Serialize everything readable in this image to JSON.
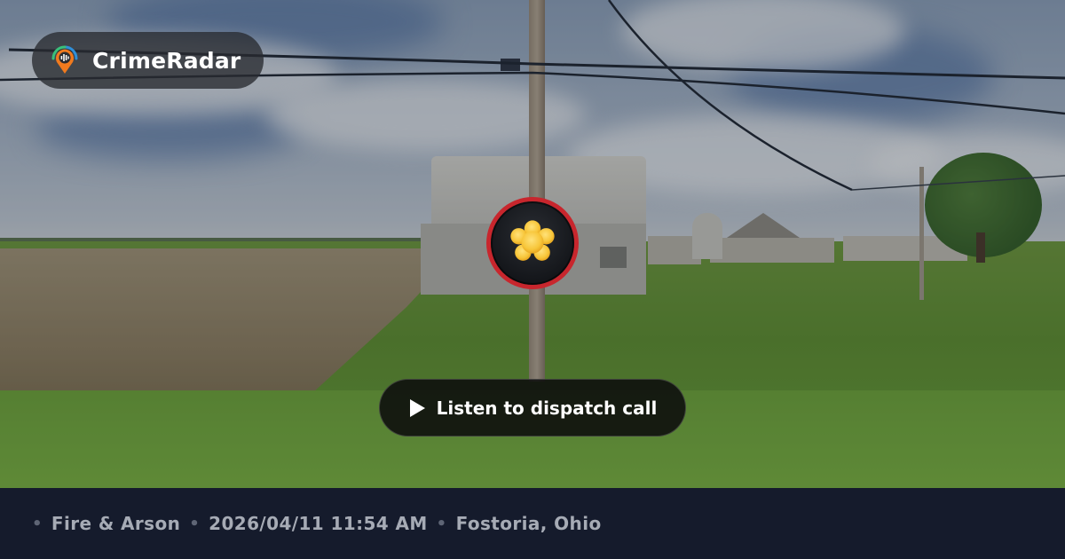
{
  "brand": {
    "name": "CrimeRadar",
    "logo_icon": "radar-pin-logo-icon",
    "colors": {
      "pin_orange": "#f07a1e",
      "pin_green": "#39c07a",
      "pin_blue": "#2f8fd8"
    }
  },
  "incident": {
    "icon": "fire-explosion-icon",
    "ring_color": "#c8262d",
    "icon_color": "#f7c63a"
  },
  "listen_button": {
    "label": "Listen to dispatch call",
    "icon": "play-icon"
  },
  "footer": {
    "separator": "•",
    "category": "Fire & Arson",
    "datetime": "2026/04/11 11:54 AM",
    "location": "Fostoria, Ohio"
  }
}
